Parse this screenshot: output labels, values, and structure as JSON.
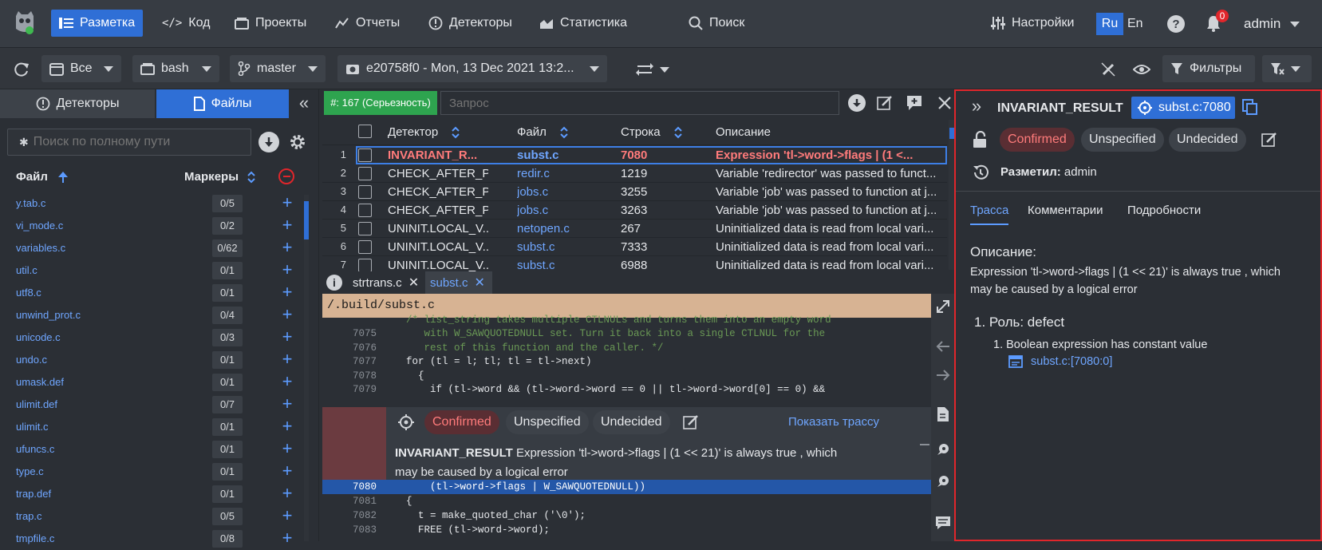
{
  "nav": {
    "items": [
      "Разметка",
      "Код",
      "Проекты",
      "Отчеты",
      "Детекторы",
      "Статистика",
      "Поиск"
    ],
    "settings": "Настройки",
    "lang_ru": "Ru",
    "lang_en": "En",
    "notif_count": "0",
    "user": "admin"
  },
  "toolbar": {
    "scope": "Все",
    "project": "bash",
    "branch": "master",
    "snapshot": "e20758f0 - Mon, 13 Dec 2021 13:2...",
    "filters": "Фильтры"
  },
  "left": {
    "tab_detectors": "Детекторы",
    "tab_files": "Файлы",
    "search_placeholder": "Поиск по полному пути",
    "col_file": "Файл",
    "col_markers": "Маркеры",
    "files": [
      {
        "name": "y.tab.c",
        "count": "0/5"
      },
      {
        "name": "vi_mode.c",
        "count": "0/2"
      },
      {
        "name": "variables.c",
        "count": "0/62"
      },
      {
        "name": "util.c",
        "count": "0/1"
      },
      {
        "name": "utf8.c",
        "count": "0/1"
      },
      {
        "name": "unwind_prot.c",
        "count": "0/4"
      },
      {
        "name": "unicode.c",
        "count": "0/3"
      },
      {
        "name": "undo.c",
        "count": "0/1"
      },
      {
        "name": "umask.def",
        "count": "0/1"
      },
      {
        "name": "ulimit.def",
        "count": "0/7"
      },
      {
        "name": "ulimit.c",
        "count": "0/1"
      },
      {
        "name": "ufuncs.c",
        "count": "0/1"
      },
      {
        "name": "type.c",
        "count": "0/1"
      },
      {
        "name": "trap.def",
        "count": "0/1"
      },
      {
        "name": "trap.c",
        "count": "0/5"
      },
      {
        "name": "tmpfile.c",
        "count": "0/8"
      }
    ]
  },
  "mid": {
    "badge": "#: 167 (Серьезность)",
    "query_placeholder": "Запрос",
    "headers": {
      "detector": "Детектор",
      "file": "Файл",
      "line": "Строка",
      "desc": "Описание"
    },
    "rows": [
      {
        "n": "1",
        "detector": "INVARIANT_R...",
        "file": "subst.c",
        "line": "7080",
        "desc": "Expression 'tl->word->flags | (1 <..."
      },
      {
        "n": "2",
        "detector": "CHECK_AFTER_P...",
        "file": "redir.c",
        "line": "1219",
        "desc": "Variable 'redirector' was passed to funct..."
      },
      {
        "n": "3",
        "detector": "CHECK_AFTER_P...",
        "file": "jobs.c",
        "line": "3255",
        "desc": "Variable 'job' was passed to function at j..."
      },
      {
        "n": "4",
        "detector": "CHECK_AFTER_P...",
        "file": "jobs.c",
        "line": "3263",
        "desc": "Variable 'job' was passed to function at j..."
      },
      {
        "n": "5",
        "detector": "UNINIT.LOCAL_V...",
        "file": "netopen.c",
        "line": "267",
        "desc": "Uninitialized data is read from local vari..."
      },
      {
        "n": "6",
        "detector": "UNINIT.LOCAL_V...",
        "file": "subst.c",
        "line": "7333",
        "desc": "Uninitialized data is read from local vari..."
      },
      {
        "n": "7",
        "detector": "UNINIT.LOCAL_V...",
        "file": "subst.c",
        "line": "6988",
        "desc": "Uninitialized data is read from local vari..."
      }
    ],
    "tabs": [
      "strtrans.c",
      "subst.c"
    ],
    "path": "/.build/subst.c",
    "code_top": [
      {
        "n": "7075",
        "text": "     with W_SAWQUOTEDNULL set. Turn it back into a single CTLNUL for the"
      },
      {
        "n": "7076",
        "text": "     rest of this function and the caller. */"
      },
      {
        "n": "7077",
        "text": "  for (tl = l; tl; tl = tl->next)"
      },
      {
        "n": "7078",
        "text": "    {"
      },
      {
        "n": "7079",
        "text": "      if (tl->word && (tl->word->word == 0 || tl->word->word[0] == 0) &&"
      }
    ],
    "code_first": "  /* list_string takes multiple CTLNULs and turns them into an empty word",
    "code_after": [
      {
        "n": "7080",
        "text": "      (tl->word->flags | W_SAWQUOTEDNULL))"
      },
      {
        "n": "7081",
        "text": "  {"
      },
      {
        "n": "7082",
        "text": "    t = make_quoted_char ('\\0');"
      },
      {
        "n": "7083",
        "text": "    FREE (tl->word->word);"
      }
    ],
    "inline": {
      "confirmed": "Confirmed",
      "unspecified": "Unspecified",
      "undecided": "Undecided",
      "show_trace": "Показать трассу",
      "title": "INVARIANT_RESULT",
      "message_1": " Expression 'tl->word->flags | (1 << 21)' is always true , which",
      "message_2": "may be caused by a logical error"
    }
  },
  "right": {
    "title": "INVARIANT_RESULT",
    "location": "subst.c:7080",
    "confirmed": "Confirmed",
    "unspecified": "Unspecified",
    "undecided": "Undecided",
    "marked_label": "Разметил:",
    "marked_user": "admin",
    "tabs": [
      "Трасса",
      "Комментарии",
      "Подробности"
    ],
    "desc_title": "Описание:",
    "desc_text": "Expression 'tl->word->flags | (1 << 21)' is always true , which may be caused by a logical error",
    "role": "1. Роль: defect",
    "sub": "1. Boolean expression has constant value",
    "link": "subst.c:[7080:0]"
  }
}
